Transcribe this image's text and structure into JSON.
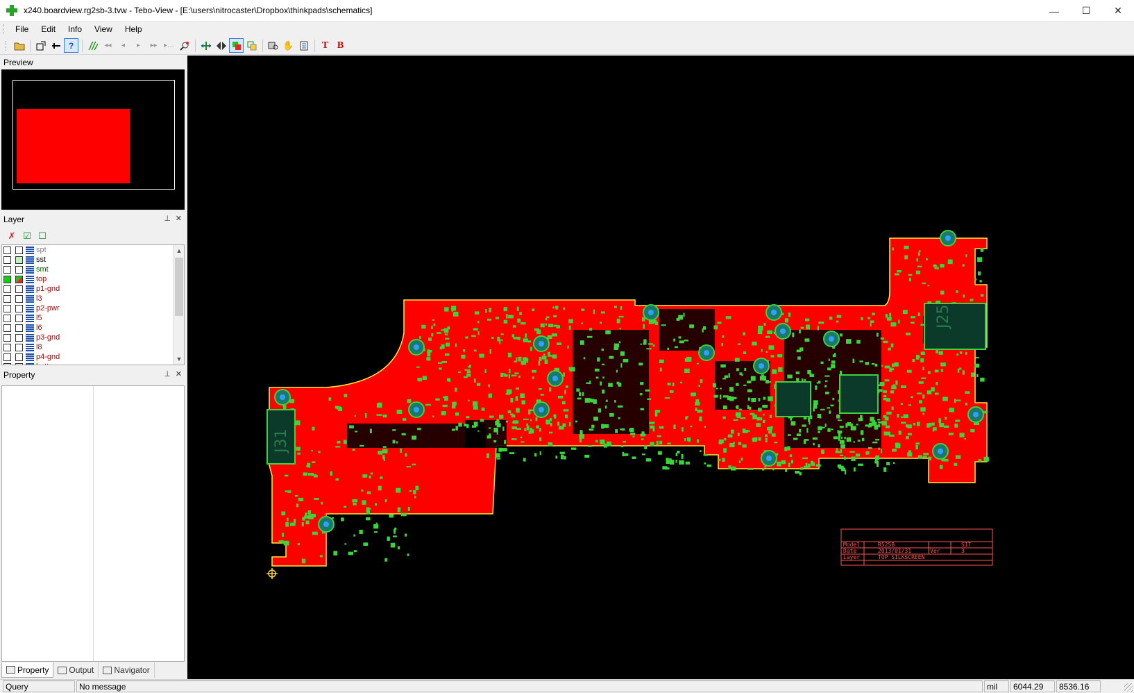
{
  "window": {
    "title": "x240.boardview.rg2sb-3.tvw - Tebo-View - [E:\\users\\nitrocaster\\Dropbox\\thinkpads\\schematics]",
    "minimize": "—",
    "maximize": "☐",
    "close": "✕"
  },
  "menu": {
    "file": "File",
    "edit": "Edit",
    "info": "Info",
    "view": "View",
    "help": "Help"
  },
  "toolbar": {
    "icons": [
      "open-folder-icon",
      "new-window-icon",
      "add-marker-icon",
      "help-icon",
      "net-icon",
      "first-icon",
      "prev-icon",
      "next-icon",
      "last-icon",
      "end-icon",
      "search-part-icon",
      "fit-board-icon",
      "flip-icon",
      "layer-color-icon",
      "layer-overlay-icon",
      "find-icon",
      "hand-icon",
      "list-icon",
      "top-side-icon",
      "bottom-side-icon"
    ],
    "help_label": "?",
    "top_label": "T",
    "bottom_label": "B"
  },
  "panels": {
    "preview": {
      "title": "Preview"
    },
    "layer": {
      "title": "Layer",
      "pin": "📌",
      "close": "✕",
      "tools": {
        "uncheck_all": "✗",
        "check_all": "☑",
        "none": "☐"
      },
      "items": [
        {
          "name": "spt",
          "color": "#888888",
          "visible": false,
          "selected_color": false
        },
        {
          "name": "sst",
          "color": "#000000",
          "visible": false,
          "selected_color": true
        },
        {
          "name": "smt",
          "color": "#006600",
          "visible": false,
          "selected_color": false
        },
        {
          "name": "top",
          "color": "#cc0000",
          "visible": true,
          "selected_color": true
        },
        {
          "name": "p1-gnd",
          "color": "#b00000",
          "visible": false,
          "selected_color": false
        },
        {
          "name": "l3",
          "color": "#b00000",
          "visible": false,
          "selected_color": false
        },
        {
          "name": "p2-pwr",
          "color": "#b00000",
          "visible": false,
          "selected_color": false
        },
        {
          "name": "l5",
          "color": "#b00000",
          "visible": false,
          "selected_color": false
        },
        {
          "name": "l6",
          "color": "#b00000",
          "visible": false,
          "selected_color": false
        },
        {
          "name": "p3-gnd",
          "color": "#b00000",
          "visible": false,
          "selected_color": false
        },
        {
          "name": "l8",
          "color": "#b00000",
          "visible": false,
          "selected_color": false
        },
        {
          "name": "p4-gnd",
          "color": "#b00000",
          "visible": false,
          "selected_color": false
        },
        {
          "name": "bottom",
          "color": "#b00000",
          "visible": false,
          "selected_color": false
        }
      ]
    },
    "property": {
      "title": "Property",
      "pin": "📌",
      "close": "✕"
    }
  },
  "bottom_tabs": [
    {
      "label": "Property",
      "active": true
    },
    {
      "label": "Output",
      "active": false
    },
    {
      "label": "Navigator",
      "active": false
    }
  ],
  "canvas": {
    "connectors": {
      "j31": "J31",
      "j25": "J25"
    },
    "title_block": {
      "rows": [
        {
          "k1": "Model",
          "v1": "R525B",
          "k2": "",
          "v2": "SIT"
        },
        {
          "k1": "Date",
          "v1": "2013/01/31",
          "k2": "Ver",
          "v2": "3"
        },
        {
          "k1": "Layer",
          "v1": "TOP SILKSCREEN",
          "k2": "",
          "v2": ""
        }
      ]
    },
    "colors": {
      "board": "#ff0000",
      "parts": "#3bd43b",
      "outline": "#ffeb3b",
      "via": "#1a7a6a"
    }
  },
  "status": {
    "mode": "Query",
    "message": "No message",
    "unit": "mil",
    "x": "6044.29",
    "y": "8536.16"
  }
}
